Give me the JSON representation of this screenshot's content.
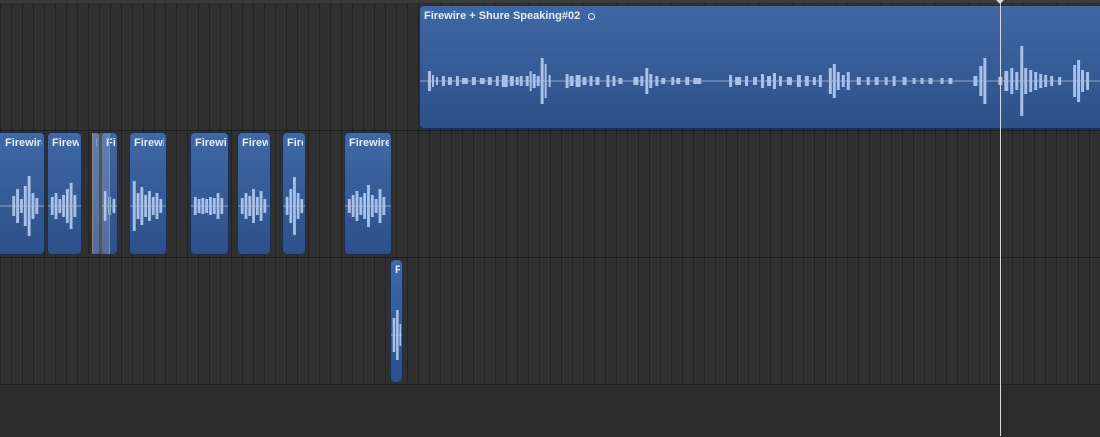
{
  "timeline": {
    "main_clip": {
      "title": "Firewire + Shure Speaking#02",
      "marker": "clip-marker-icon"
    },
    "connected_clips": [
      {
        "title": "Firewire"
      },
      {
        "title": "Firew"
      },
      {
        "title": "F"
      },
      {
        "title": "Fi"
      },
      {
        "title": "Firewi"
      },
      {
        "title": "Firewi"
      },
      {
        "title": "Firew"
      },
      {
        "title": "Fire"
      },
      {
        "title": "Firewire"
      }
    ],
    "lower_clip": {
      "title": "F"
    }
  },
  "colors": {
    "clip_fill": "#3f68a4",
    "waveform": "#a9c0e8",
    "playhead": "#d8d8d8",
    "background": "#303030"
  }
}
